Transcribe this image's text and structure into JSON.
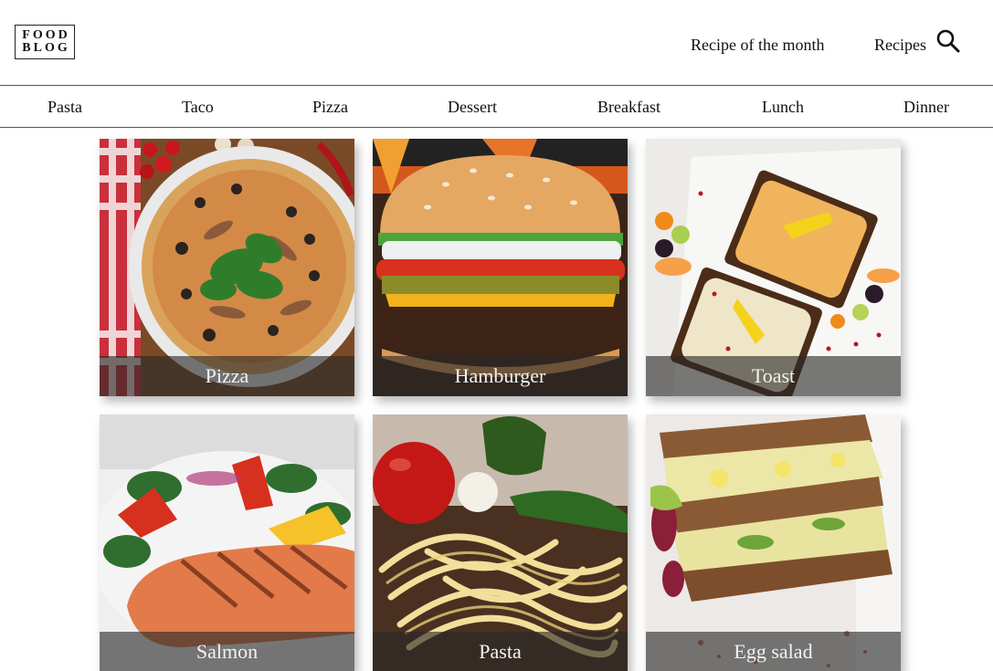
{
  "brand": {
    "logo_line1": "FOOD",
    "logo_line2": "BLOG"
  },
  "header_nav": {
    "recipe_of_month": "Recipe of the month",
    "recipes": "Recipes",
    "search_icon": "search-icon"
  },
  "categories": [
    "Pasta",
    "Taco",
    "Pizza",
    "Dessert",
    "Breakfast",
    "Lunch",
    "Dinner"
  ],
  "tiles": [
    {
      "caption": "Pizza"
    },
    {
      "caption": "Hamburger"
    },
    {
      "caption": "Toast"
    },
    {
      "caption": "Salmon"
    },
    {
      "caption": "Pasta"
    },
    {
      "caption": "Egg salad"
    }
  ],
  "colors": {
    "caption_overlay": "#282828",
    "divider": "#555555",
    "text": "#111111"
  }
}
